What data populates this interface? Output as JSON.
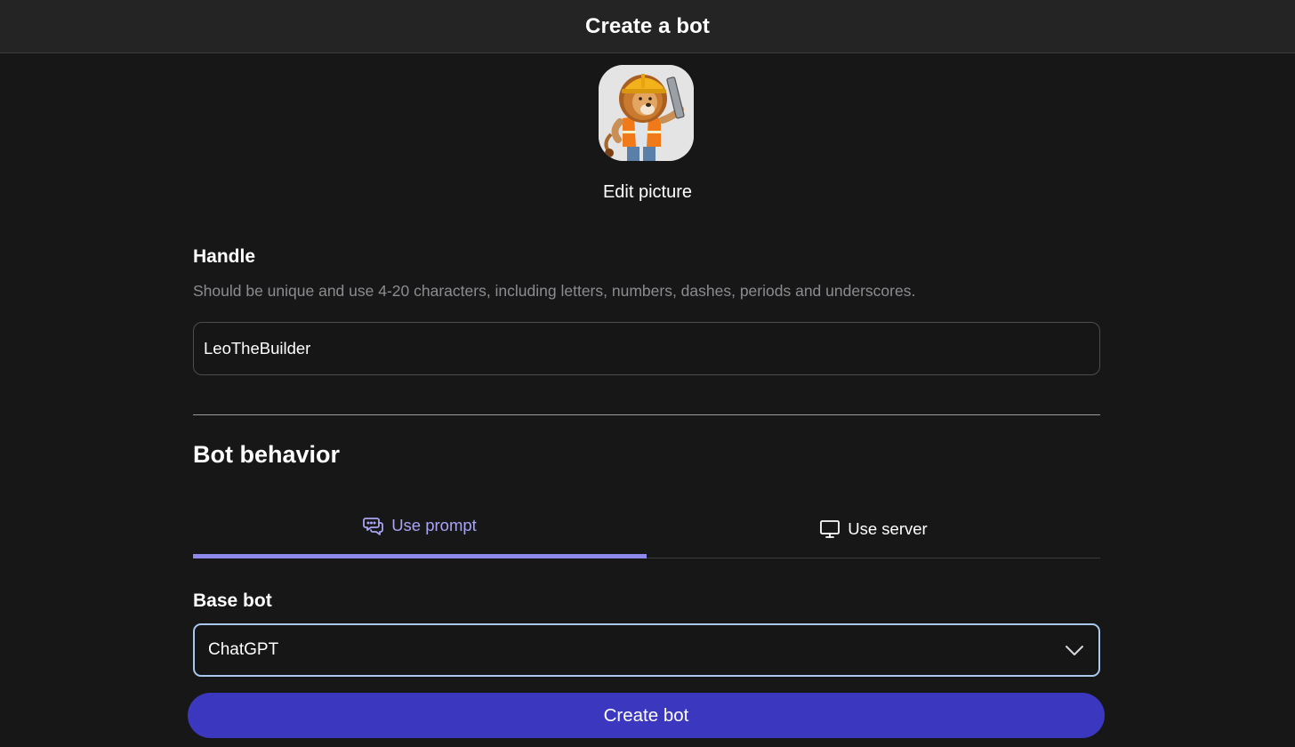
{
  "header": {
    "title": "Create a bot"
  },
  "avatar": {
    "icon": "lion-builder-avatar",
    "edit_label": "Edit picture"
  },
  "handle": {
    "label": "Handle",
    "hint": "Should be unique and use 4-20 characters, including letters, numbers, dashes, periods and underscores.",
    "value": "LeoTheBuilder"
  },
  "behavior": {
    "title": "Bot behavior",
    "tabs": [
      {
        "label": "Use prompt",
        "icon": "chat-bubbles-icon",
        "active": true
      },
      {
        "label": "Use server",
        "icon": "monitor-icon",
        "active": false
      }
    ]
  },
  "base_bot": {
    "label": "Base bot",
    "selected": "ChatGPT"
  },
  "actions": {
    "create_label": "Create bot"
  },
  "colors": {
    "accent": "#8e89ec",
    "button": "#3b38bf",
    "select_border": "#a9c8f0",
    "background": "#171718"
  }
}
